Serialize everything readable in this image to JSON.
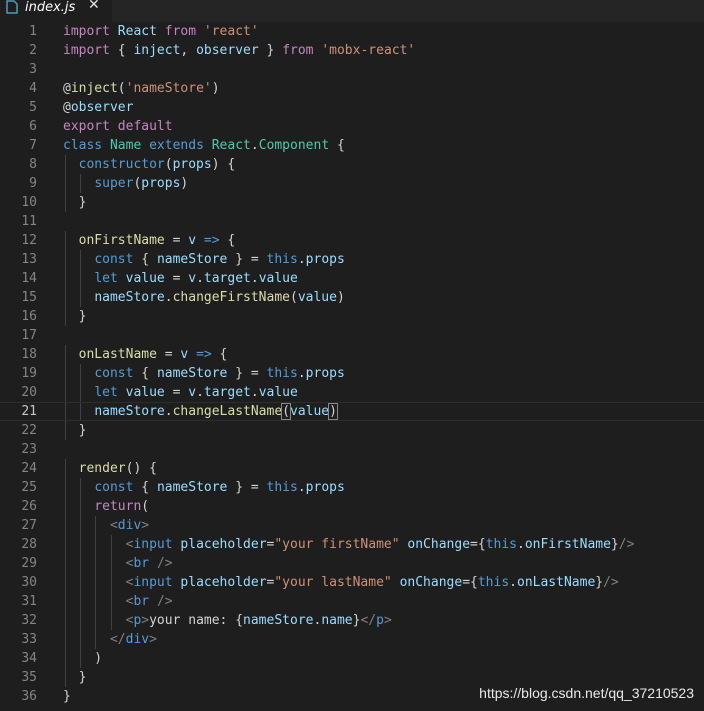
{
  "tab": {
    "filename": "index.js",
    "close_glyph": "✕",
    "icon": "javascript-file-icon"
  },
  "editor": {
    "active_line": 21,
    "lines": [
      [
        [
          "k",
          "import"
        ],
        [
          "d",
          " "
        ],
        [
          "v",
          "React"
        ],
        [
          "d",
          " "
        ],
        [
          "k",
          "from"
        ],
        [
          "d",
          " "
        ],
        [
          "s",
          "'react'"
        ]
      ],
      [
        [
          "k",
          "import"
        ],
        [
          "d",
          " { "
        ],
        [
          "v",
          "inject"
        ],
        [
          "d",
          ", "
        ],
        [
          "v",
          "observer"
        ],
        [
          "d",
          " } "
        ],
        [
          "k",
          "from"
        ],
        [
          "d",
          " "
        ],
        [
          "s",
          "'mobx-react'"
        ]
      ],
      [],
      [
        [
          "d",
          "@"
        ],
        [
          "f",
          "inject"
        ],
        [
          "d",
          "("
        ],
        [
          "s",
          "'nameStore'"
        ],
        [
          "d",
          ")"
        ]
      ],
      [
        [
          "d",
          "@"
        ],
        [
          "v",
          "observer"
        ]
      ],
      [
        [
          "k",
          "export"
        ],
        [
          "d",
          " "
        ],
        [
          "k",
          "default"
        ]
      ],
      [
        [
          "b",
          "class"
        ],
        [
          "d",
          " "
        ],
        [
          "c",
          "Name"
        ],
        [
          "d",
          " "
        ],
        [
          "b",
          "extends"
        ],
        [
          "d",
          " "
        ],
        [
          "c",
          "React"
        ],
        [
          "d",
          "."
        ],
        [
          "c",
          "Component"
        ],
        [
          "d",
          " {"
        ]
      ],
      [
        [
          "d",
          "  "
        ],
        [
          "b",
          "constructor"
        ],
        [
          "d",
          "("
        ],
        [
          "v",
          "props"
        ],
        [
          "d",
          ") {"
        ]
      ],
      [
        [
          "d",
          "    "
        ],
        [
          "b",
          "super"
        ],
        [
          "d",
          "("
        ],
        [
          "v",
          "props"
        ],
        [
          "d",
          ")"
        ]
      ],
      [
        [
          "d",
          "  }"
        ]
      ],
      [],
      [
        [
          "d",
          "  "
        ],
        [
          "f",
          "onFirstName"
        ],
        [
          "d",
          " = "
        ],
        [
          "v",
          "v"
        ],
        [
          "d",
          " "
        ],
        [
          "b",
          "=>"
        ],
        [
          "d",
          " {"
        ]
      ],
      [
        [
          "d",
          "    "
        ],
        [
          "b",
          "const"
        ],
        [
          "d",
          " { "
        ],
        [
          "v",
          "nameStore"
        ],
        [
          "d",
          " } = "
        ],
        [
          "b",
          "this"
        ],
        [
          "d",
          "."
        ],
        [
          "v",
          "props"
        ]
      ],
      [
        [
          "d",
          "    "
        ],
        [
          "b",
          "let"
        ],
        [
          "d",
          " "
        ],
        [
          "v",
          "value"
        ],
        [
          "d",
          " = "
        ],
        [
          "v",
          "v"
        ],
        [
          "d",
          "."
        ],
        [
          "v",
          "target"
        ],
        [
          "d",
          "."
        ],
        [
          "v",
          "value"
        ]
      ],
      [
        [
          "d",
          "    "
        ],
        [
          "v",
          "nameStore"
        ],
        [
          "d",
          "."
        ],
        [
          "f",
          "changeFirstName"
        ],
        [
          "d",
          "("
        ],
        [
          "v",
          "value"
        ],
        [
          "d",
          ")"
        ]
      ],
      [
        [
          "d",
          "  }"
        ]
      ],
      [],
      [
        [
          "d",
          "  "
        ],
        [
          "f",
          "onLastName"
        ],
        [
          "d",
          " = "
        ],
        [
          "v",
          "v"
        ],
        [
          "d",
          " "
        ],
        [
          "b",
          "=>"
        ],
        [
          "d",
          " {"
        ]
      ],
      [
        [
          "d",
          "    "
        ],
        [
          "b",
          "const"
        ],
        [
          "d",
          " { "
        ],
        [
          "v",
          "nameStore"
        ],
        [
          "d",
          " } = "
        ],
        [
          "b",
          "this"
        ],
        [
          "d",
          "."
        ],
        [
          "v",
          "props"
        ]
      ],
      [
        [
          "d",
          "    "
        ],
        [
          "b",
          "let"
        ],
        [
          "d",
          " "
        ],
        [
          "v",
          "value"
        ],
        [
          "d",
          " = "
        ],
        [
          "v",
          "v"
        ],
        [
          "d",
          "."
        ],
        [
          "v",
          "target"
        ],
        [
          "d",
          "."
        ],
        [
          "v",
          "value"
        ]
      ],
      [
        [
          "d",
          "    "
        ],
        [
          "v",
          "nameStore"
        ],
        [
          "d",
          "."
        ],
        [
          "f",
          "changeLastName"
        ],
        [
          "d",
          "(",
          "bracket"
        ],
        [
          "v",
          "value"
        ],
        [
          "d",
          ")",
          "bracket"
        ]
      ],
      [
        [
          "d",
          "  }"
        ]
      ],
      [],
      [
        [
          "d",
          "  "
        ],
        [
          "f",
          "render"
        ],
        [
          "d",
          "() {"
        ]
      ],
      [
        [
          "d",
          "    "
        ],
        [
          "b",
          "const"
        ],
        [
          "d",
          " { "
        ],
        [
          "v",
          "nameStore"
        ],
        [
          "d",
          " } = "
        ],
        [
          "b",
          "this"
        ],
        [
          "d",
          "."
        ],
        [
          "v",
          "props"
        ]
      ],
      [
        [
          "d",
          "    "
        ],
        [
          "k",
          "return"
        ],
        [
          "d",
          "("
        ]
      ],
      [
        [
          "d",
          "      "
        ],
        [
          "t",
          "<"
        ],
        [
          "b",
          "div"
        ],
        [
          "t",
          ">"
        ]
      ],
      [
        [
          "d",
          "        "
        ],
        [
          "t",
          "<"
        ],
        [
          "b",
          "input"
        ],
        [
          "d",
          " "
        ],
        [
          "v",
          "placeholder"
        ],
        [
          "d",
          "="
        ],
        [
          "s",
          "\"your firstName\""
        ],
        [
          "d",
          " "
        ],
        [
          "v",
          "onChange"
        ],
        [
          "d",
          "={"
        ],
        [
          "b",
          "this"
        ],
        [
          "d",
          "."
        ],
        [
          "v",
          "onFirstName"
        ],
        [
          "d",
          "}"
        ],
        [
          "t",
          "/>"
        ]
      ],
      [
        [
          "d",
          "        "
        ],
        [
          "t",
          "<"
        ],
        [
          "b",
          "br"
        ],
        [
          "d",
          " "
        ],
        [
          "t",
          "/>"
        ]
      ],
      [
        [
          "d",
          "        "
        ],
        [
          "t",
          "<"
        ],
        [
          "b",
          "input"
        ],
        [
          "d",
          " "
        ],
        [
          "v",
          "placeholder"
        ],
        [
          "d",
          "="
        ],
        [
          "s",
          "\"your lastName\""
        ],
        [
          "d",
          " "
        ],
        [
          "v",
          "onChange"
        ],
        [
          "d",
          "={"
        ],
        [
          "b",
          "this"
        ],
        [
          "d",
          "."
        ],
        [
          "v",
          "onLastName"
        ],
        [
          "d",
          "}"
        ],
        [
          "t",
          "/>"
        ]
      ],
      [
        [
          "d",
          "        "
        ],
        [
          "t",
          "<"
        ],
        [
          "b",
          "br"
        ],
        [
          "d",
          " "
        ],
        [
          "t",
          "/>"
        ]
      ],
      [
        [
          "d",
          "        "
        ],
        [
          "t",
          "<"
        ],
        [
          "b",
          "p"
        ],
        [
          "t",
          ">"
        ],
        [
          "d",
          "your name: {"
        ],
        [
          "v",
          "nameStore"
        ],
        [
          "d",
          "."
        ],
        [
          "v",
          "name"
        ],
        [
          "d",
          "}"
        ],
        [
          "t",
          "</"
        ],
        [
          "b",
          "p"
        ],
        [
          "t",
          ">"
        ]
      ],
      [
        [
          "d",
          "      "
        ],
        [
          "t",
          "</"
        ],
        [
          "b",
          "div"
        ],
        [
          "t",
          ">"
        ]
      ],
      [
        [
          "d",
          "    )"
        ]
      ],
      [
        [
          "d",
          "  }"
        ]
      ],
      [
        [
          "d",
          "}"
        ]
      ]
    ]
  },
  "watermark": "https://blog.csdn.net/qq_37210523"
}
